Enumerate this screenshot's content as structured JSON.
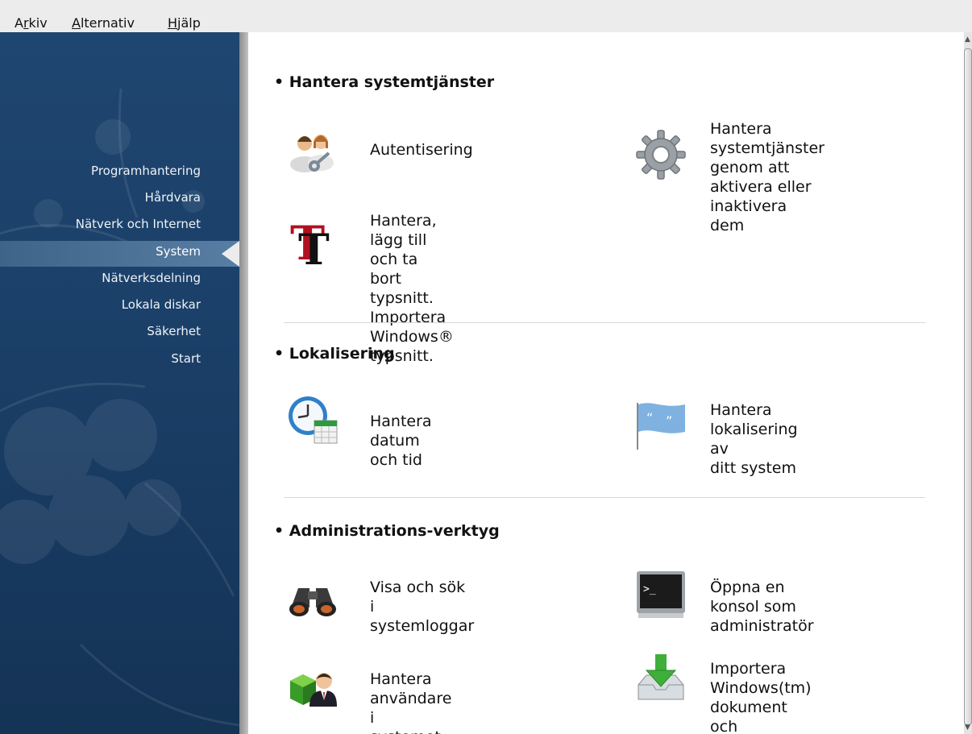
{
  "menu": [
    {
      "pre": "A",
      "key": "r",
      "post": "kiv"
    },
    {
      "pre": "",
      "key": "A",
      "post": "lternativ"
    },
    {
      "pre": "",
      "key": "H",
      "post": "jälp"
    }
  ],
  "sidebar": {
    "items": [
      {
        "label": "Programhantering"
      },
      {
        "label": "Hårdvara"
      },
      {
        "label": "Nätverk och Internet"
      },
      {
        "label": "System"
      },
      {
        "label": "Nätverksdelning"
      },
      {
        "label": "Lokala diskar"
      },
      {
        "label": "Säkerhet"
      },
      {
        "label": "Start"
      }
    ],
    "selected": "System"
  },
  "sections": [
    {
      "title": "• Hantera systemtjänster",
      "items": [
        {
          "icon": "authentication-users-icon",
          "label": "Autentisering"
        },
        {
          "icon": "gear-services-icon",
          "label": "Hantera systemtjänster\ngenom att aktivera eller\ninaktivera dem"
        },
        {
          "icon": "fonts-icon",
          "label": "Hantera, lägg till och ta\nbort typsnitt. Importera\nWindows® typsnitt."
        }
      ]
    },
    {
      "title": "• Lokalisering",
      "items": [
        {
          "icon": "clock-calendar-icon",
          "label": "Hantera datum och tid"
        },
        {
          "icon": "flag-locale-icon",
          "label": "Hantera lokalisering av\nditt system"
        }
      ]
    },
    {
      "title": "• Administrations-verktyg",
      "items": [
        {
          "icon": "binoculars-logs-icon",
          "label": "Visa och sök i\nsystemloggar"
        },
        {
          "icon": "terminal-console-icon",
          "label": "Öppna en konsol som\nadministratör"
        },
        {
          "icon": "user-management-icon",
          "label": "Hantera användare i\nsystemet"
        },
        {
          "icon": "download-import-icon",
          "label": "Importera Windows(tm)\ndokument och\ninställningar"
        }
      ]
    }
  ],
  "colors": {
    "sidebar": "#1b4069",
    "selection": "#587ea4",
    "background": "#ffffff",
    "menubar": "#ececec"
  }
}
